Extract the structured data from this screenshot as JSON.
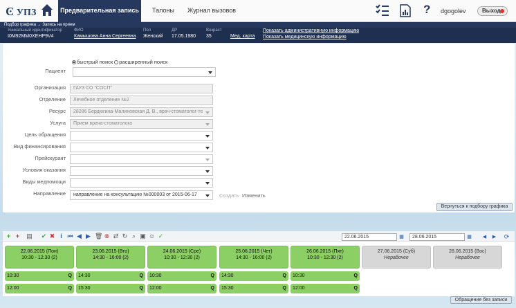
{
  "app": {
    "logo": "УПЗ",
    "user": "dgogolev",
    "logout": "Выход"
  },
  "nav": {
    "tabs": [
      "Предварительная запись",
      "Талоны",
      "Журнал вызовов"
    ]
  },
  "breadcrumb": "Подбор графика → Запись на прием",
  "patient": {
    "id_label": "Уникальный идентификатор",
    "id": "I0M92MM0XEHP9V4",
    "fio_label": "ФИО",
    "fio": "Камышова Анна Сергеевна",
    "sex_label": "Пол",
    "sex": "Женский",
    "dob_label": "ДР",
    "dob": "17.05.1980",
    "age_label": "Возраст",
    "age": "35",
    "card": "Мед. карта",
    "admin_link": "Показать административную информацию",
    "med_link": "Показать медицинскую информацию"
  },
  "search": {
    "quick": "быстрый поиск",
    "extended": "расширенный поиск"
  },
  "form": {
    "patient_label": "Пациент",
    "patient_value": "",
    "org_label": "Организация",
    "org_value": "ГАУЗ СО \"СОСП\"",
    "dept_label": "Отделение",
    "dept_value": "Лечебное отделение №2",
    "res_label": "Ресурс",
    "res_value": "28286 Бердюгина-Малиновская Д. В., врач-стоматолог-те",
    "svc_label": "Услуга",
    "svc_value": "Прием врача-стоматолога",
    "goal_label": "Цель обращения",
    "goal_value": "",
    "fin_label": "Вид финансирования",
    "fin_value": "",
    "price_label": "Прейскурант",
    "price_value": "",
    "cond_label": "Условия оказания",
    "cond_value": "",
    "care_label": "Виды медпомощи",
    "care_value": "",
    "dir_label": "Направление",
    "dir_value": "направление на консультацию №000003 от 2015-06-17",
    "create": "Создать",
    "edit": "Изменить",
    "back": "Вернуться к подбору графика"
  },
  "schedule": {
    "date_from": "22.06.2015",
    "date_to": "28.06.2015",
    "days": [
      {
        "date": "22.06.2015 (Пон)",
        "time": "10:30 - 12:30 (2)"
      },
      {
        "date": "23.06.2015 (Вто)",
        "time": "14:30 - 16:00 (2)"
      },
      {
        "date": "24.06.2015 (Сре)",
        "time": "10:30 - 12:30 (2)"
      },
      {
        "date": "25.06.2015 (Чет)",
        "time": "14:30 - 16:00 (2)"
      },
      {
        "date": "26.06.2015 (Пят)",
        "time": "10:30 - 12:30 (2)"
      },
      {
        "date": "27.06.2015 (Суб)",
        "time": "Нерабочее"
      },
      {
        "date": "28.06.2015 (Вос)",
        "time": "Нерабочее"
      }
    ],
    "slots_row1": [
      "10:30",
      "14:30",
      "10:30",
      "14:30",
      "10:30"
    ],
    "slots_row2": [
      "12:00",
      "15:30",
      "12:00",
      "15:30",
      "12:00"
    ],
    "slot_marker": "Q",
    "no_record": "Обращение без записи"
  }
}
